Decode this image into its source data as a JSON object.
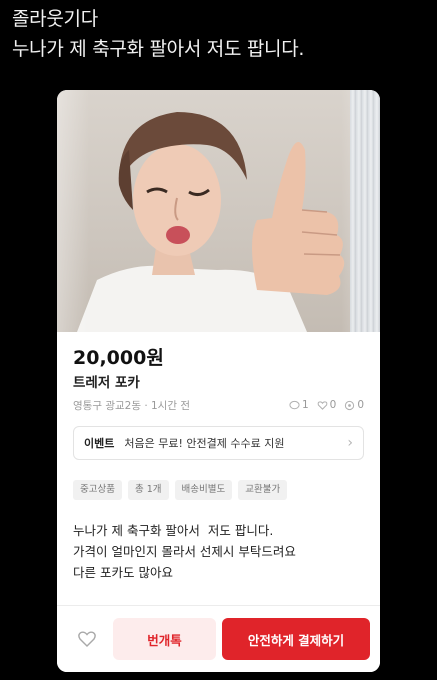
{
  "caption": {
    "line1": "졸라웃기다",
    "line2": "누나가 제 축구화 팔아서 저도 팝니다."
  },
  "listing": {
    "price": "20,000원",
    "title": "트레저 포카",
    "location_time": "영통구 광교2동 · 1시간 전",
    "stats": {
      "chats": "1",
      "likes": "0",
      "views": "0"
    },
    "event": {
      "tag": "이벤트",
      "text": "처음은 무료! 안전결제 수수료 지원"
    },
    "tags": [
      "중고상품",
      "총 1개",
      "배송비별도",
      "교환불가"
    ],
    "description": "누나가 제 축구화 팔아서  저도 팝니다.\n가격이 얼마인지 몰라서 선제시 부탁드려요\n다른 포카도 많아요"
  },
  "actions": {
    "chat_label": "번개톡",
    "pay_label": "안전하게 결제하기"
  },
  "colors": {
    "accent": "#e0242a",
    "accent_light": "#fdecec",
    "background": "#000000"
  },
  "icons": {
    "like": "heart-outline-icon",
    "event_arrow": "chevron-right-icon"
  }
}
